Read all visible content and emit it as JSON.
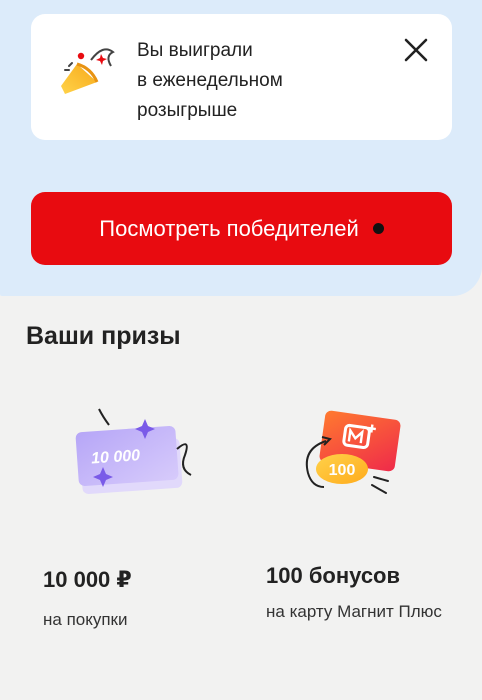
{
  "notice": {
    "lines": [
      "Вы выиграли",
      "в еженедельном",
      "розыгрыше"
    ],
    "icon": "party-popper-icon",
    "close_icon": "close-icon"
  },
  "cta": {
    "label": "Посмотреть победителей",
    "color": "#e80b10"
  },
  "prizes_section": {
    "title": "Ваши призы",
    "items": [
      {
        "card_text": "10 000",
        "value": "10 000 ₽",
        "description": "на покупки",
        "icon": "gift-card-icon"
      },
      {
        "badge_text": "100",
        "value": "100 бонусов",
        "description": "на карту Магнит Плюс",
        "icon": "magnit-plus-bonus-icon"
      }
    ]
  },
  "colors": {
    "top_panel": "#dcebfa",
    "page_background": "#f2f2f1",
    "accent": "#e80b10"
  }
}
